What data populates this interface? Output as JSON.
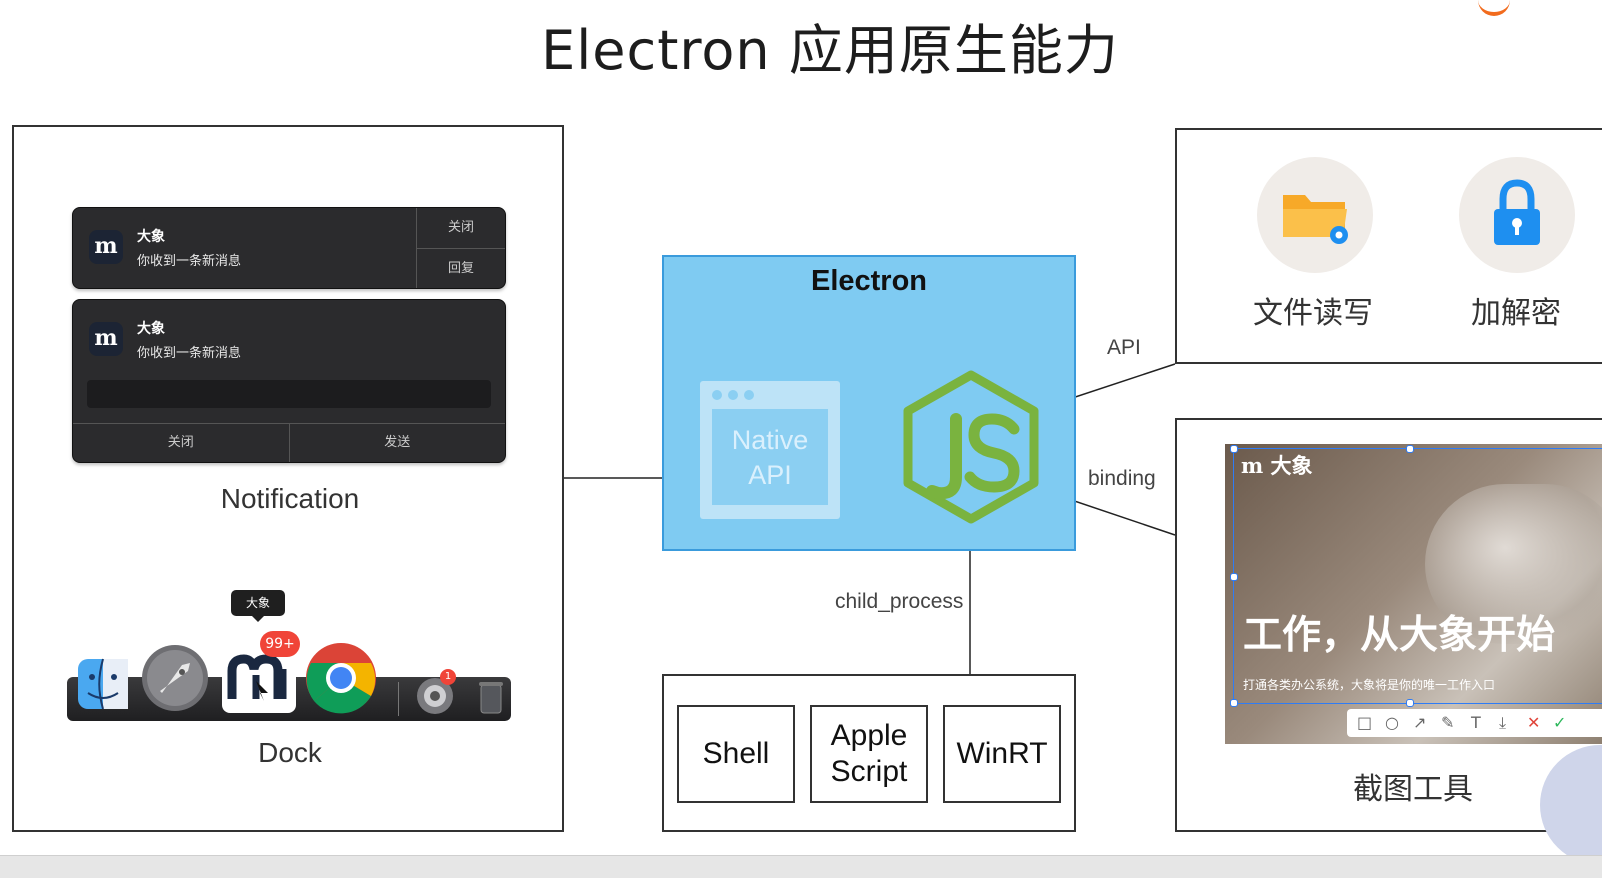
{
  "title": "Electron 应用原生能力",
  "notifications": [
    {
      "sender": "大象",
      "message": "你收到一条新消息",
      "actions": [
        "关闭",
        "回复"
      ]
    },
    {
      "sender": "大象",
      "message": "你收到一条新消息",
      "actions": [
        "关闭",
        "发送"
      ]
    }
  ],
  "left_panel": {
    "notification_caption": "Notification",
    "dock_caption": "Dock",
    "dock_tooltip": "大象",
    "dock_badge": "99+",
    "dock_small_badge": "1"
  },
  "electron": {
    "title": "Electron",
    "native_api_line1": "Native",
    "native_api_line2": "API"
  },
  "edges": {
    "api": "API",
    "binding": "binding",
    "child_process": "child_process"
  },
  "child_processes": {
    "shell": "Shell",
    "apple_script_line1": "Apple",
    "apple_script_line2": "Script",
    "winrt": "WinRT"
  },
  "features": {
    "file_rw": "文件读写",
    "crypto": "加解密"
  },
  "screenshot_tool": {
    "caption": "截图工具",
    "brand": "大象",
    "headline": "工作，从大象开始",
    "subtitle": "打通各类办公系统，大象将是你的唯一工作入口"
  },
  "colors": {
    "electron_fill": "#7fcbf2",
    "node_green": "#7ab33f",
    "folder_orange": "#f7a928",
    "lock_blue": "#1e8ff0"
  }
}
